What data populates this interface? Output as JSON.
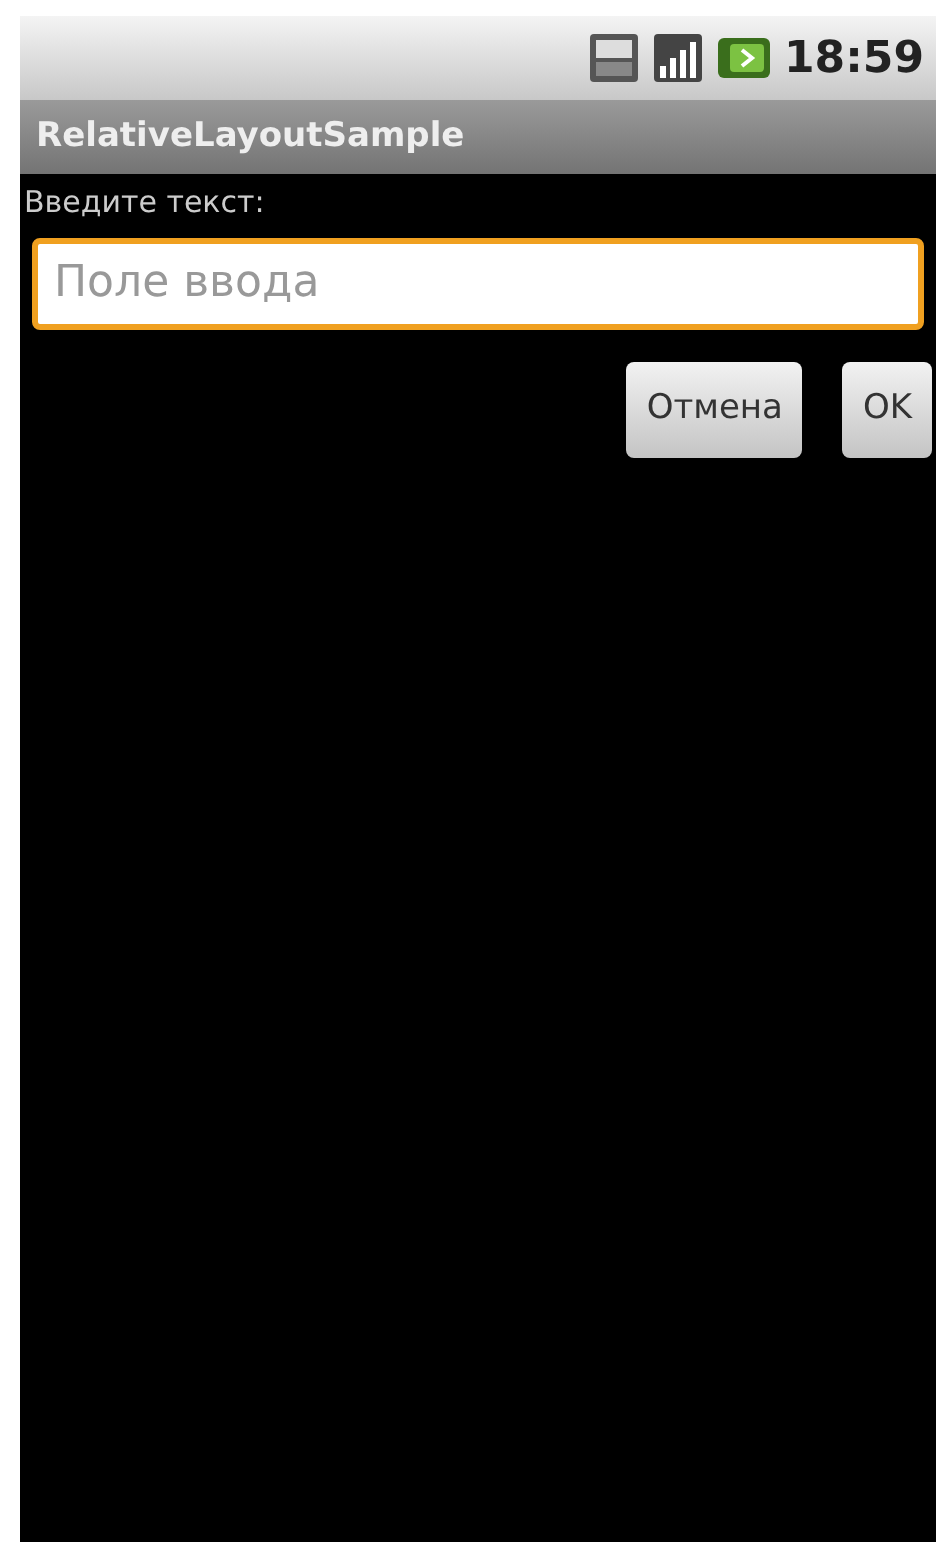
{
  "status_bar": {
    "time": "18:59"
  },
  "title_bar": {
    "title": "RelativeLayoutSample"
  },
  "form": {
    "label": "Введите текст:",
    "field": {
      "placeholder": "Поле ввода",
      "focused": true
    },
    "buttons": [
      {
        "label": "Отмена"
      },
      {
        "label": "OK"
      }
    ]
  }
}
